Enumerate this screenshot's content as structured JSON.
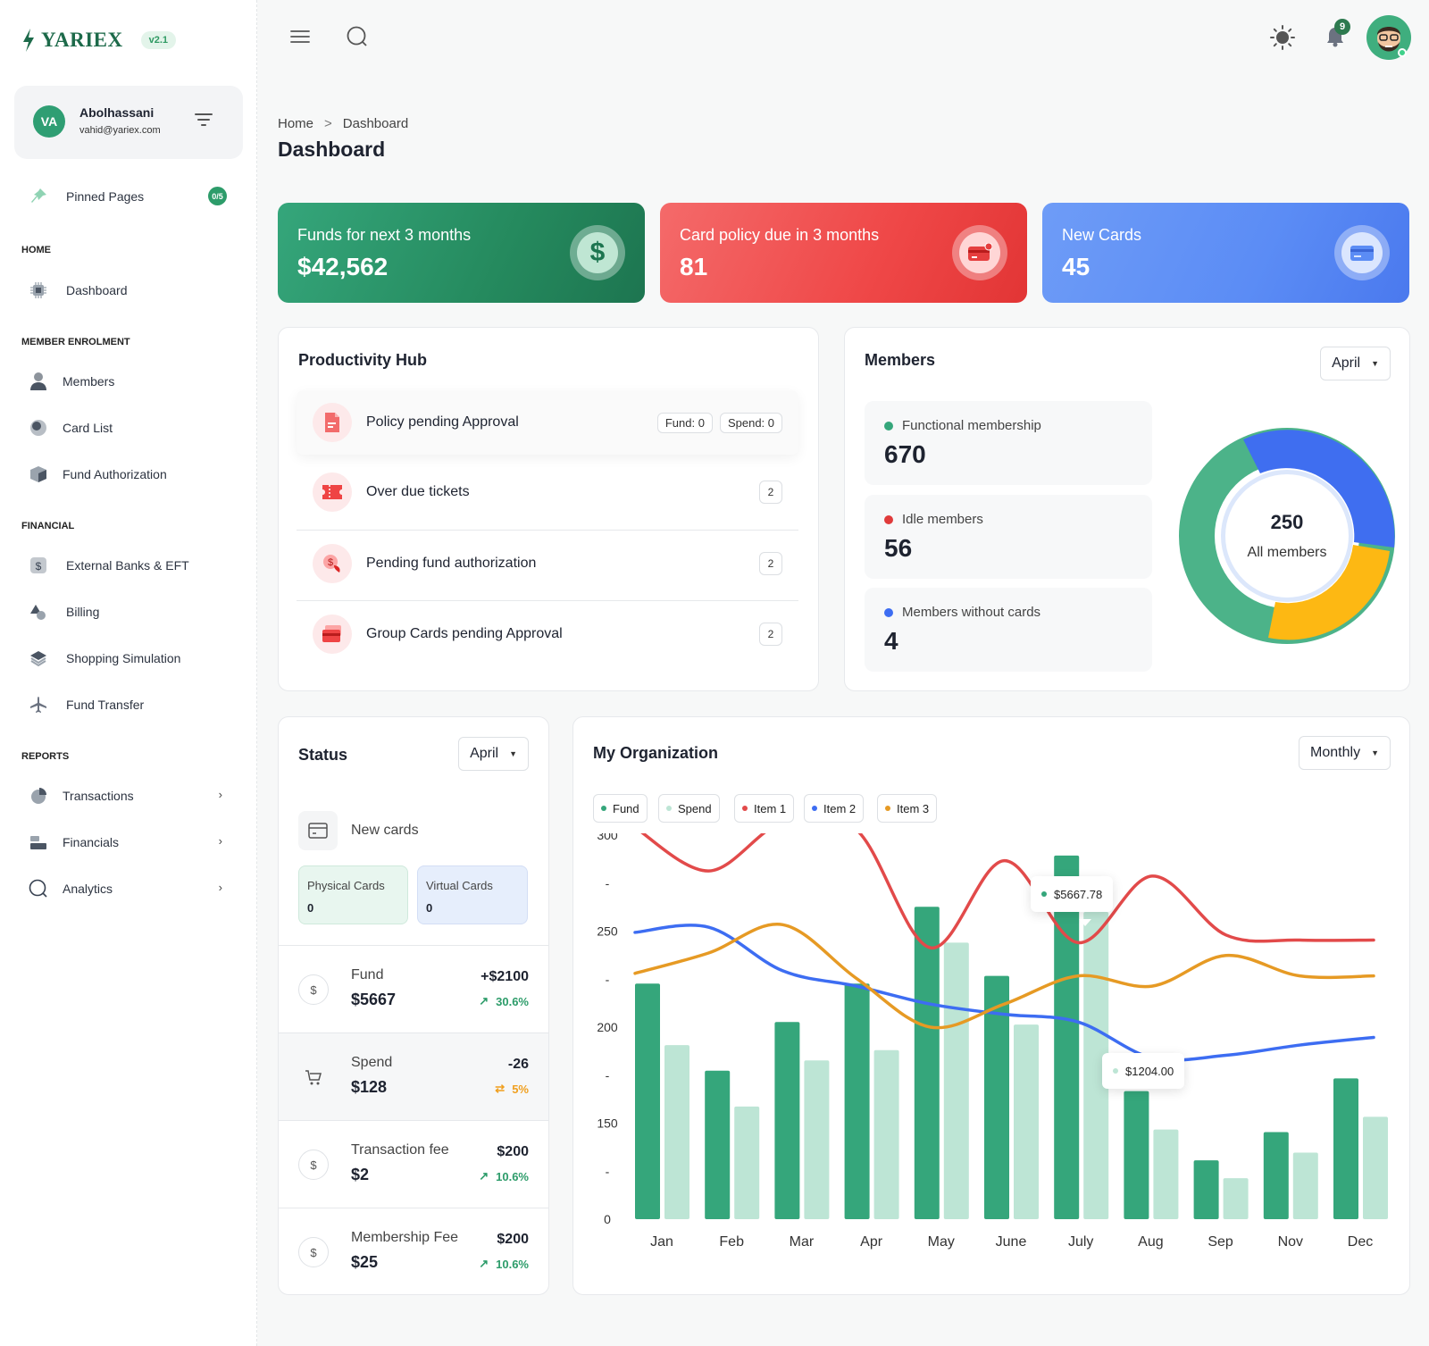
{
  "app": {
    "name": "YARIEX",
    "version": "v2.1"
  },
  "user": {
    "initials": "VA",
    "name": "Abolhassani",
    "email": "vahid@yariex.com"
  },
  "pinned": {
    "label": "Pinned Pages",
    "badge": "0/5"
  },
  "sidebar": {
    "home_label": "HOME",
    "dashboard": "Dashboard",
    "enrolment_label": "MEMBER ENROLMENT",
    "members": "Members",
    "card_list": "Card List",
    "fund_authorization": "Fund Authorization",
    "financial_label": "FINANCIAL",
    "external_banks": "External Banks & EFT",
    "billing": "Billing",
    "shopping_simulation": "Shopping Simulation",
    "fund_transfer": "Fund Transfer",
    "reports_label": "REPORTS",
    "transactions": "Transactions",
    "financials": "Financials",
    "analytics": "Analytics"
  },
  "header": {
    "notification_count": "9"
  },
  "breadcrumb": {
    "home": "Home",
    "sep": ">",
    "current": "Dashboard"
  },
  "page_title": "Dashboard",
  "stats": [
    {
      "label": "Funds for next 3 months",
      "value": "$42,562",
      "color": "#2b9a6a"
    },
    {
      "label": "Card policy due in 3 months",
      "value": "81",
      "color": "#ee4848"
    },
    {
      "label": "New Cards",
      "value": "45",
      "color": "#5b8cf5"
    }
  ],
  "productivity": {
    "title": "Productivity Hub",
    "items": [
      {
        "label": "Policy pending Approval",
        "fund": "Fund: 0",
        "spend": "Spend: 0"
      },
      {
        "label": "Over due tickets",
        "count": "2"
      },
      {
        "label": "Pending fund authorization",
        "count": "2"
      },
      {
        "label": "Group Cards pending Approval",
        "count": "2"
      }
    ]
  },
  "members": {
    "title": "Members",
    "month": "April",
    "items": [
      {
        "label": "Functional membership",
        "value": "670",
        "color": "#35a67b"
      },
      {
        "label": "Idle members",
        "value": "56",
        "color": "#e03b3b"
      },
      {
        "label": "Members without cards",
        "value": "4",
        "color": "#3d6df2"
      }
    ],
    "total": "250",
    "total_label": "All members"
  },
  "status": {
    "title": "Status",
    "month": "April",
    "new_cards": "New cards",
    "physical": {
      "label": "Physical Cards",
      "value": "0"
    },
    "virtual": {
      "label": "Virtual Cards",
      "value": "0"
    },
    "rows": [
      {
        "name": "Fund",
        "value": "$5667",
        "change": "+$2100",
        "pct": "30.6%",
        "pct_color": "#2d9c6a"
      },
      {
        "name": "Spend",
        "value": "$128",
        "change": "-26",
        "pct": "5%",
        "pct_color": "#f0a020"
      },
      {
        "name": "Transaction fee",
        "value": "$2",
        "change": "$200",
        "pct": "10.6%",
        "pct_color": "#2d9c6a"
      },
      {
        "name": "Membership Fee",
        "value": "$25",
        "change": "$200",
        "pct": "10.6%",
        "pct_color": "#2d9c6a"
      }
    ]
  },
  "org": {
    "title": "My Organization",
    "period": "Monthly"
  },
  "chart_data": {
    "type": "bar",
    "categories": [
      "Jan",
      "Feb",
      "Mar",
      "Apr",
      "May",
      "June",
      "July",
      "Aug",
      "Sep",
      "Nov",
      "Dec"
    ],
    "y_ticks": [
      "300",
      "-",
      "250",
      "-",
      "200",
      "-",
      "150",
      "-",
      "0"
    ],
    "series": [
      {
        "name": "Fund",
        "type": "bar",
        "color": "#35a67b",
        "values": [
          92,
          58,
          77,
          92,
          122,
          95,
          142,
          50,
          23,
          34,
          55
        ]
      },
      {
        "name": "Spend",
        "type": "bar",
        "color": "#bde5d5",
        "values": [
          68,
          44,
          62,
          66,
          108,
          76,
          120,
          35,
          16,
          26,
          40
        ]
      },
      {
        "name": "Item 1",
        "type": "line",
        "color": "#e24a4a",
        "values": [
          153,
          136,
          155,
          152,
          106,
          140,
          108,
          134,
          111,
          109,
          109
        ]
      },
      {
        "name": "Item 2",
        "type": "line",
        "color": "#3d6df2",
        "values": [
          112,
          114,
          97,
          91,
          84,
          80,
          77,
          63,
          64,
          68,
          71
        ]
      },
      {
        "name": "Item 3",
        "type": "line",
        "color": "#e69a24",
        "values": [
          96,
          104,
          115,
          94,
          75,
          84,
          95,
          91,
          103,
          95,
          95
        ]
      }
    ],
    "tooltips": [
      "$5667.78",
      "$1204.00"
    ]
  }
}
